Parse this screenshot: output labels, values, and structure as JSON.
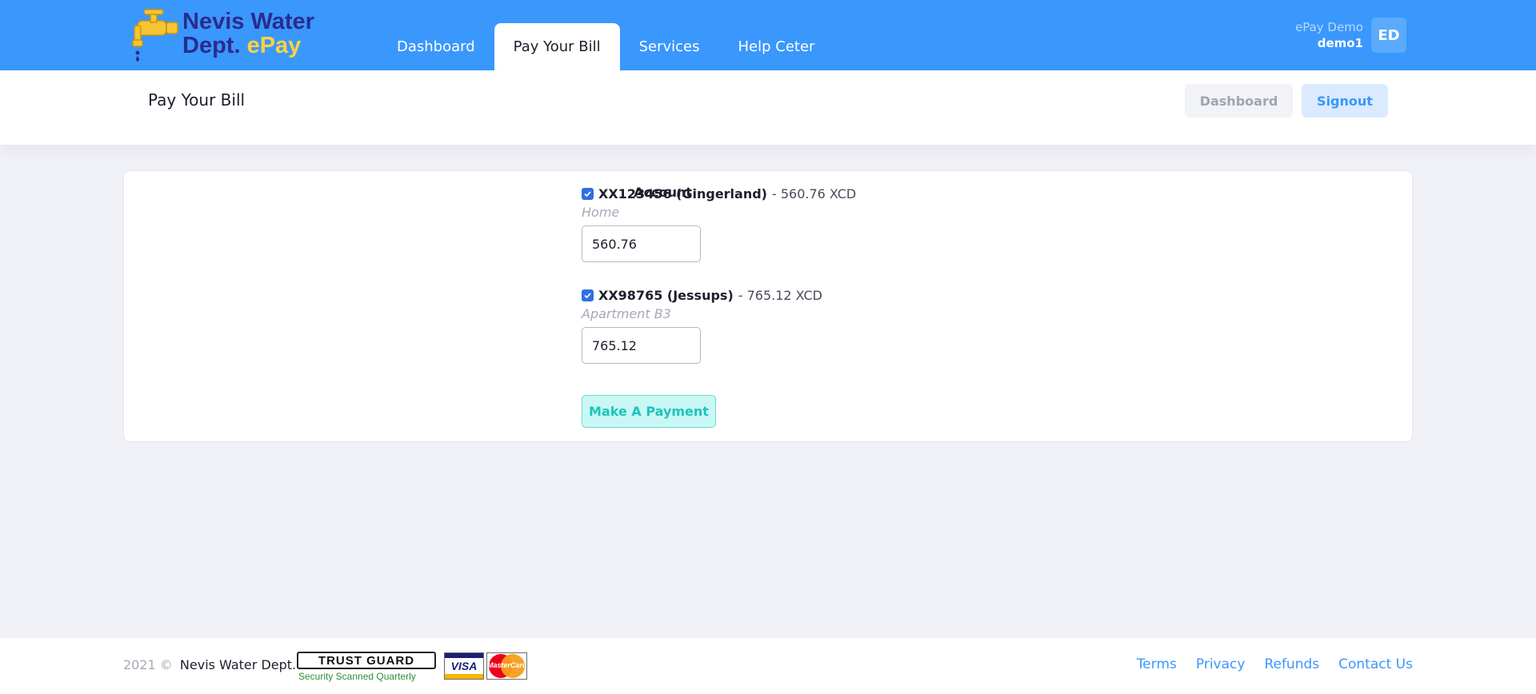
{
  "brand": {
    "line1": "Nevis Water",
    "line2": "Dept.",
    "line2_accent": "ePay"
  },
  "nav": {
    "items": [
      {
        "label": "Dashboard",
        "active": false
      },
      {
        "label": "Pay Your Bill",
        "active": true
      },
      {
        "label": "Services",
        "active": false
      },
      {
        "label": "Help Ceter",
        "active": false
      }
    ]
  },
  "user": {
    "greeting": "ePay Demo",
    "username": "demo1",
    "initials": "ED"
  },
  "subheader": {
    "title": "Pay Your Bill",
    "dashboard_label": "Dashboard",
    "signout_label": "Signout"
  },
  "form": {
    "account_label": "Account",
    "accounts": [
      {
        "id": "XX123456 (Gingerland)",
        "amount_text": "- 560.76 XCD",
        "description": "Home",
        "input_value": "560.76",
        "checked": true
      },
      {
        "id": "XX98765 (Jessups)",
        "amount_text": "- 765.12 XCD",
        "description": "Apartment B3",
        "input_value": "765.12",
        "checked": true
      }
    ],
    "submit_label": "Make A Payment"
  },
  "footer": {
    "year": "2021 ©",
    "org": "Nevis Water Dept.",
    "trust_title": "TRUST GUARD",
    "trust_sub": "Security Scanned Quarterly",
    "visa": "VISA",
    "mastercard": "MasterCard",
    "links": [
      "Terms",
      "Privacy",
      "Refunds",
      "Contact Us"
    ]
  },
  "colors": {
    "header_bg": "#3a97fc",
    "page_bg": "#f0f1f6",
    "primary": "#3a97fc",
    "success": "#1bc5bd",
    "brand_yellow": "#ffd23f",
    "brand_navy": "#2b2b8f"
  },
  "icons": [
    "water-faucet-icon",
    "checkbox-checked-icon",
    "shield-icon"
  ]
}
